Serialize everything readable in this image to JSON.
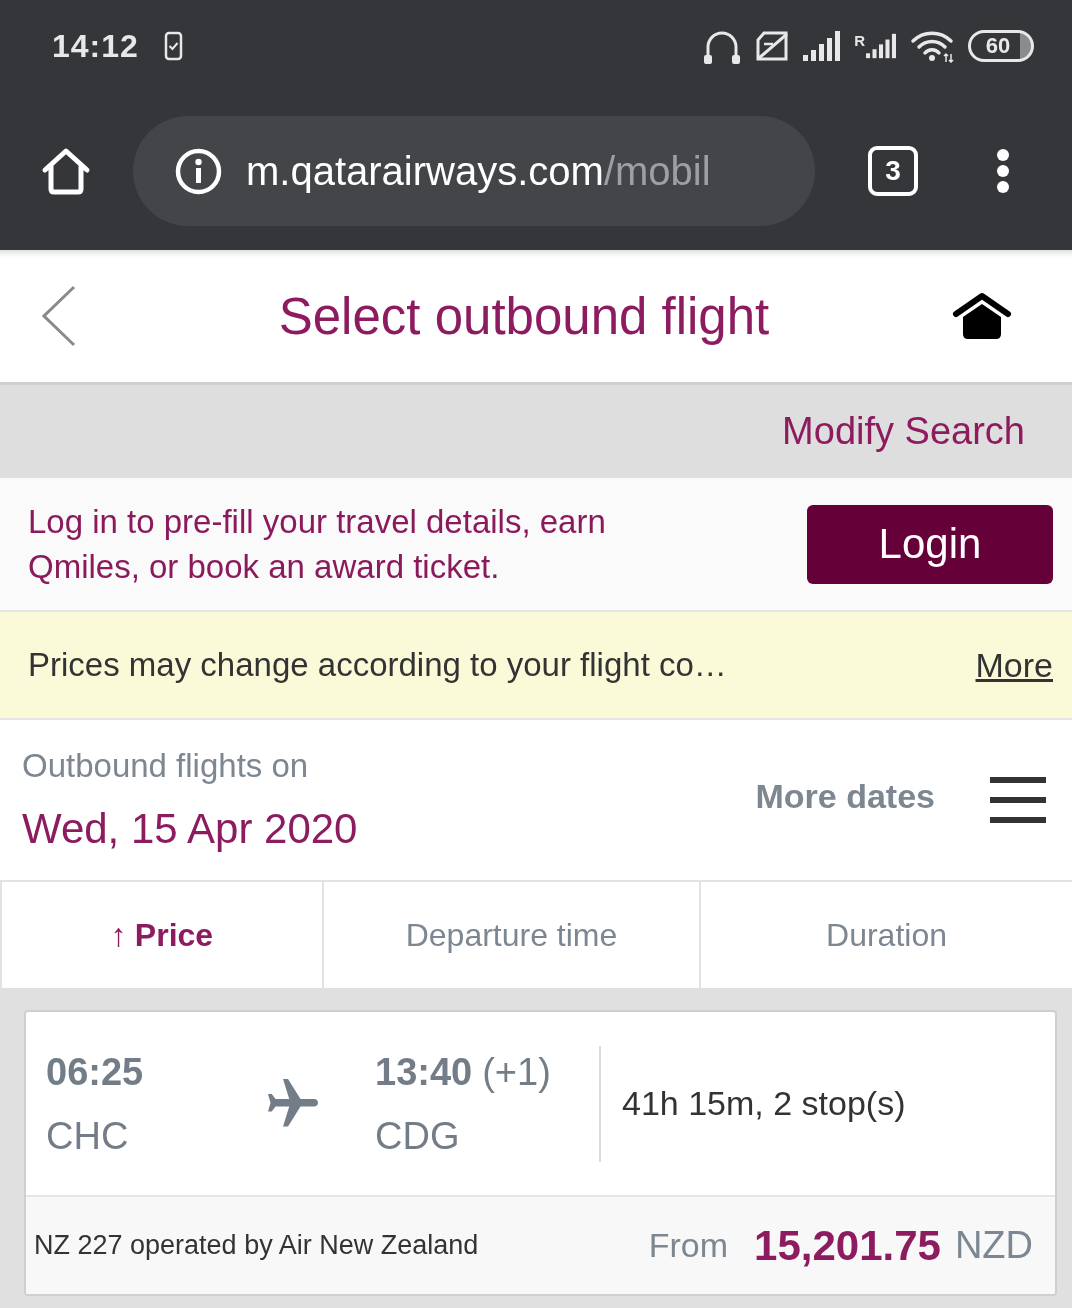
{
  "status_bar": {
    "time": "14:12",
    "roaming_label": "R",
    "battery": "60"
  },
  "browser": {
    "url_host": "m.qatarairways.com",
    "url_path": "/mobil",
    "tab_count": "3"
  },
  "header": {
    "title": "Select outbound flight"
  },
  "modify_search": {
    "label": "Modify Search"
  },
  "login_banner": {
    "message": "Log in to pre-fill your travel details, earn Qmiles, or book an award ticket.",
    "button": "Login"
  },
  "notice": {
    "message": "Prices may change according to your flight co…",
    "link": "More"
  },
  "date_section": {
    "label": "Outbound flights on",
    "date": "Wed, 15 Apr 2020",
    "more_dates": "More dates"
  },
  "sort_tabs": [
    {
      "label": "Price",
      "arrow": "↑",
      "selected": true
    },
    {
      "label": "Departure time",
      "selected": false
    },
    {
      "label": "Duration",
      "selected": false
    }
  ],
  "flights": [
    {
      "departure_time": "06:25",
      "departure_airport": "CHC",
      "arrival_time": "13:40",
      "day_offset": "(+1)",
      "arrival_airport": "CDG",
      "duration": "41h 15m, 2 stop(s)",
      "operator": "NZ 227 operated by Air New Zealand",
      "price_prefix": "From",
      "price": "15,201.75",
      "currency": "NZD"
    }
  ]
}
